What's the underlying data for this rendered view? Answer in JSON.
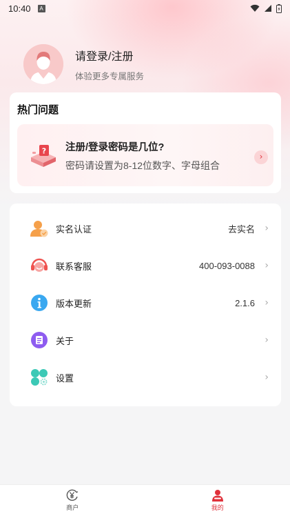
{
  "status_bar": {
    "time": "10:40",
    "notif_letter": "A"
  },
  "profile": {
    "title": "请登录/注册",
    "subtitle": "体验更多专属服务"
  },
  "hot": {
    "section_title": "热门问题",
    "question": "注册/登录密码是几位?",
    "answer": "密码请设置为8-12位数字、字母组合",
    "arrow": "›"
  },
  "menu": {
    "items": [
      {
        "label": "实名认证",
        "value": "去实名",
        "icon": "user-verify-icon"
      },
      {
        "label": "联系客服",
        "value": "400-093-0088",
        "icon": "headset-icon"
      },
      {
        "label": "版本更新",
        "value": "2.1.6",
        "icon": "info-icon"
      },
      {
        "label": "关于",
        "value": "",
        "icon": "document-icon"
      },
      {
        "label": "设置",
        "value": "",
        "icon": "settings-icon"
      }
    ],
    "chevron": "›"
  },
  "tabbar": {
    "tabs": [
      {
        "label": "商户",
        "active": false,
        "icon": "yen-coin-icon"
      },
      {
        "label": "我的",
        "active": true,
        "icon": "profile-icon"
      }
    ]
  },
  "colors": {
    "accent": "#e0313b",
    "avatar_bg": "#f8c9c9",
    "verify_orange": "#f5a04a",
    "service_red": "#ef5350",
    "info_blue": "#3aa8f0",
    "about_purple": "#8e5cf0",
    "settings_teal": "#3cc9b6"
  }
}
